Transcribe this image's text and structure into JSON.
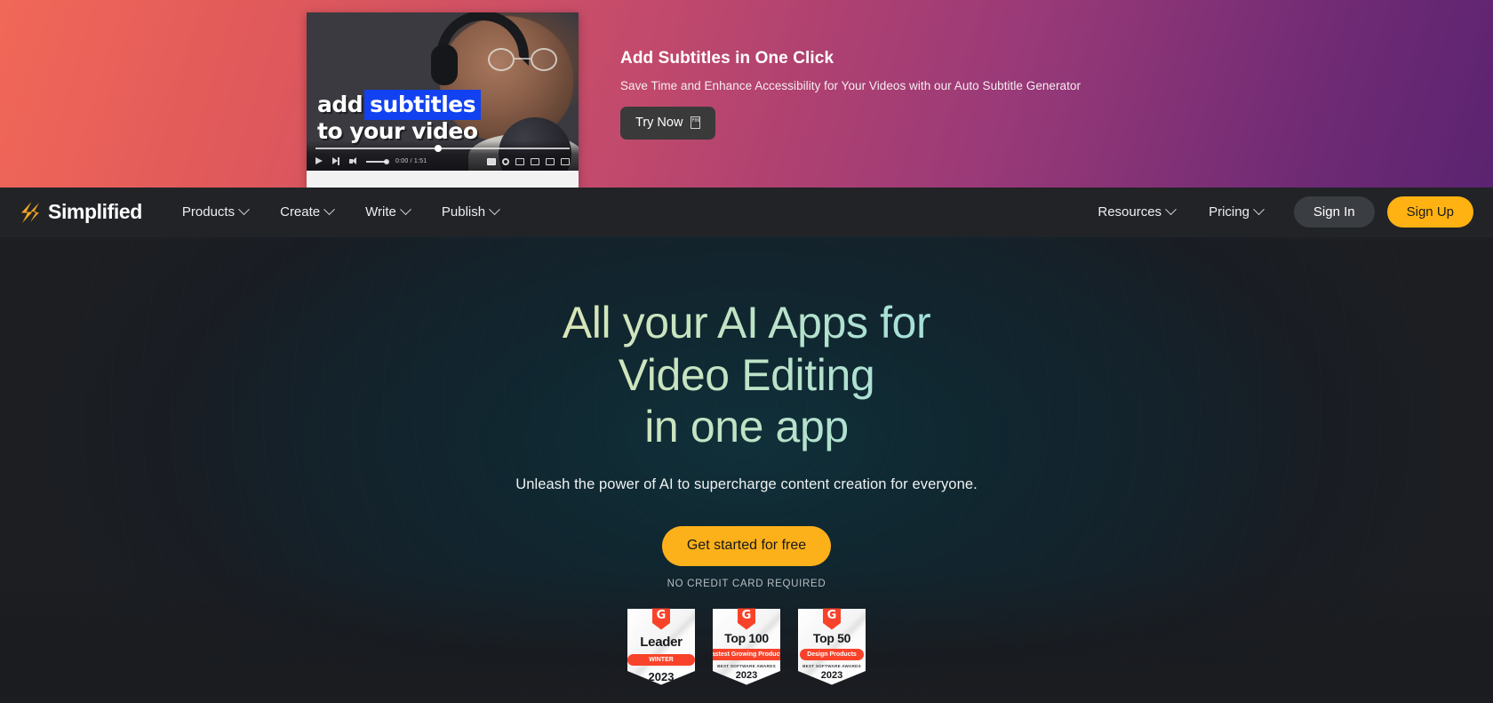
{
  "promo": {
    "title": "Add Subtitles in One Click",
    "subtitle": "Save Time and Enhance Accessibility for Your Videos with our Auto Subtitle Generator",
    "cta_label": "Try Now",
    "cta_icon_glyph": "F061",
    "video": {
      "caption_line1_a": "add",
      "caption_line1_b": "subtitles",
      "caption_line2": "to your video",
      "time": "0:00 / 1:51"
    },
    "colors": {
      "gradient_start": "#f0604f",
      "gradient_end": "#5b2370",
      "cta_bg": "#3a3a3a",
      "caption_highlight": "#1141f0"
    }
  },
  "nav": {
    "brand": "Simplified",
    "brand_icon": "lightning-bolt-icon",
    "left_items": [
      {
        "label": "Products",
        "has_caret": true
      },
      {
        "label": "Create",
        "has_caret": true
      },
      {
        "label": "Write",
        "has_caret": true
      },
      {
        "label": "Publish",
        "has_caret": true
      }
    ],
    "right_items": [
      {
        "label": "Resources",
        "has_caret": true
      },
      {
        "label": "Pricing",
        "has_caret": true
      }
    ],
    "sign_in": "Sign In",
    "sign_up": "Sign Up",
    "colors": {
      "bar_bg": "#212326",
      "brand_accent": "#f5a623",
      "signup_bg": "#ffb211"
    }
  },
  "hero": {
    "headline_line1": "All your AI Apps for",
    "headline_line2": "Video Editing",
    "headline_line3": "in one app",
    "subheadline": "Unleash the power of AI to supercharge content creation for everyone.",
    "cta_label": "Get started for free",
    "note": "NO CREDIT CARD REQUIRED",
    "colors": {
      "gradient_text_start": "#efeaa8",
      "gradient_text_end": "#9bdcec",
      "cta_bg": "#fcb11a",
      "background": "#14222b"
    },
    "badges": [
      {
        "provider_mark": "G",
        "rank": "Leader",
        "ribbon": "WINTER",
        "awards": "",
        "year": "2023"
      },
      {
        "provider_mark": "G",
        "rank": "Top 100",
        "ribbon": "Fastest Growing Products",
        "awards": "BEST SOFTWARE AWARDS",
        "year": "2023"
      },
      {
        "provider_mark": "G",
        "rank": "Top 50",
        "ribbon": "Design Products",
        "awards": "BEST SOFTWARE AWARDS",
        "year": "2023"
      }
    ]
  }
}
